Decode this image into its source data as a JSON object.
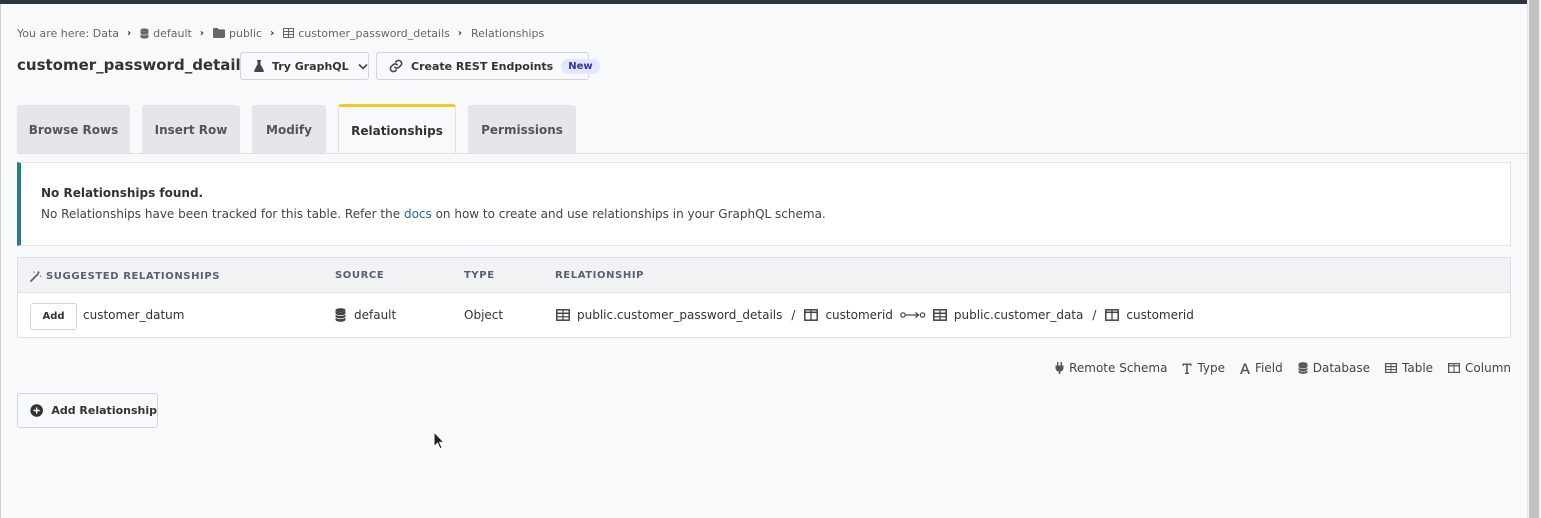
{
  "breadcrumb": {
    "prefix": "You are here:",
    "items": [
      "Data",
      "default",
      "public",
      "customer_password_details",
      "Relationships"
    ]
  },
  "header": {
    "title": "customer_password_details",
    "graphql_button": "Try GraphQL",
    "rest_button": "Create REST Endpoints",
    "rest_badge": "New"
  },
  "tabs": [
    {
      "label": "Browse Rows",
      "active": false
    },
    {
      "label": "Insert Row",
      "active": false
    },
    {
      "label": "Modify",
      "active": false
    },
    {
      "label": "Relationships",
      "active": true
    },
    {
      "label": "Permissions",
      "active": false
    }
  ],
  "alert": {
    "title": "No Relationships found.",
    "text_before": "No Relationships have been tracked for this table. Refer the ",
    "link": "docs",
    "text_after": " on how to create and use relationships in your GraphQL schema."
  },
  "suggestions": {
    "columns": [
      "SUGGESTED RELATIONSHIPS",
      "SOURCE",
      "TYPE",
      "RELATIONSHIP"
    ],
    "rows": [
      {
        "add_label": "Add",
        "name": "customer_datum",
        "source": "default",
        "type": "Object",
        "from_table": "public.customer_password_details",
        "from_column": "customerid",
        "to_table": "public.customer_data",
        "to_column": "customerid"
      }
    ]
  },
  "legend": {
    "items": [
      "Remote Schema",
      "Type",
      "Field",
      "Database",
      "Table",
      "Column"
    ]
  },
  "add_relationship": {
    "label": "Add Relationship"
  },
  "colors": {
    "accent_tab": "#f4c724",
    "alert_border": "#267d86",
    "link": "#2563a7",
    "topbar": "#2b3440"
  }
}
